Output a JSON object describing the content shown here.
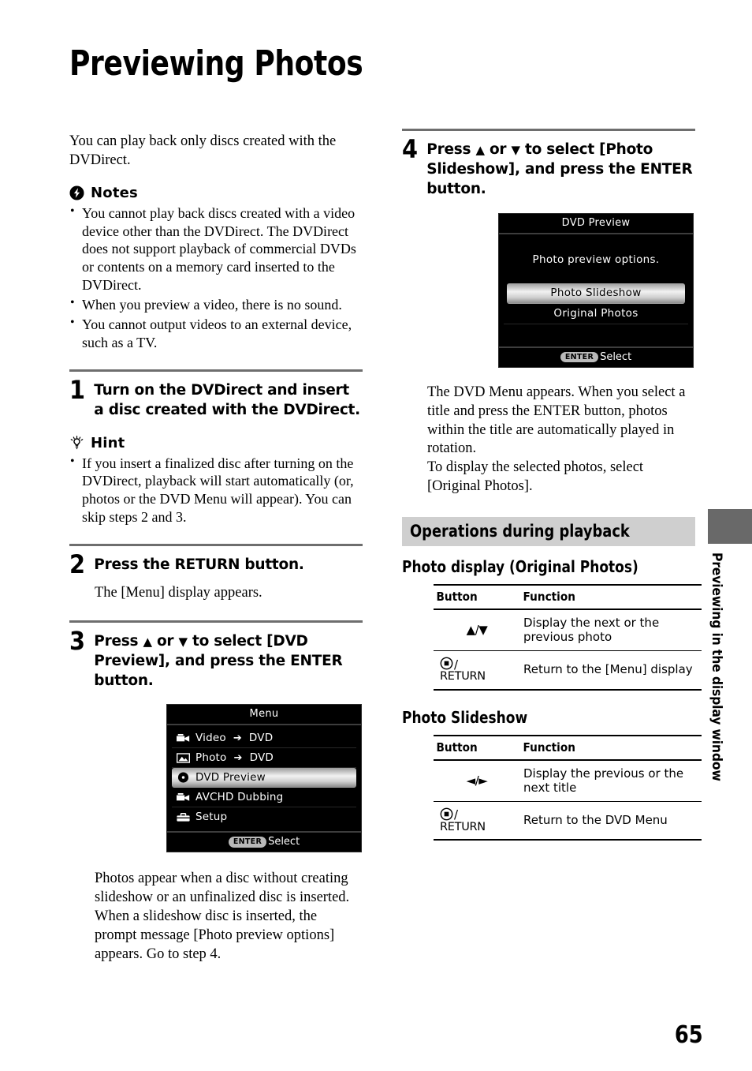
{
  "page": {
    "title": "Previewing Photos",
    "number": "65",
    "side_tab": "Previewing in the display window"
  },
  "left_column": {
    "intro": "You can play back only discs created with the DVDirect.",
    "notes": {
      "icon": "notes-exclamation-icon",
      "heading": "Notes",
      "items": [
        "You cannot play back discs created with a video device other than the DVDirect. The DVDirect does not support playback of commercial DVDs or contents on a memory card inserted to the DVDirect.",
        "When you preview a video, there is no sound.",
        "You cannot output videos to an external device, such as a TV."
      ]
    },
    "step1": {
      "number": "1",
      "text": "Turn on the DVDirect and insert a disc created with the DVDirect."
    },
    "hint": {
      "icon": "lightbulb-icon",
      "heading": "Hint",
      "items": [
        "If you insert a finalized disc after turning on the DVDirect, playback will start automatically (or, photos or the DVD Menu will appear). You can skip steps 2 and 3."
      ]
    },
    "step2": {
      "number": "2",
      "text": "Press the RETURN button.",
      "result": "The [Menu] display appears."
    },
    "step3": {
      "number": "3",
      "text_a": "Press ",
      "arrow_up": "♦",
      "text_b": " or ",
      "arrow_down": "♦",
      "text_c": " to select [DVD Preview], and press the ENTER button."
    },
    "menu_screen": {
      "title": "Menu",
      "rows": [
        {
          "icon": "video-camera-icon",
          "label": "Video",
          "arrow": "➔",
          "target": "DVD",
          "selected": false
        },
        {
          "icon": "photo-icon",
          "label": "Photo",
          "arrow": "➔",
          "target": "DVD",
          "selected": false
        },
        {
          "icon": "disc-icon",
          "label": "DVD  Preview",
          "arrow": "",
          "target": "",
          "selected": true
        },
        {
          "icon": "video-camera-icon",
          "label": "AVCHD  Dubbing",
          "arrow": "",
          "target": "",
          "selected": false
        },
        {
          "icon": "toolbox-icon",
          "label": "Setup",
          "arrow": "",
          "target": "",
          "selected": false
        }
      ],
      "footer_badge": "ENTER",
      "footer_label": "Select"
    },
    "closing": "Photos appear when a disc without creating slideshow or an unfinalized disc is inserted. When a slideshow disc is inserted, the prompt message [Photo preview options] appears. Go to step 4."
  },
  "right_column": {
    "step4": {
      "number": "4",
      "text_a": "Press ",
      "arrow_up": "♦",
      "text_b": " or ",
      "arrow_down": "♦",
      "text_c": " to select [Photo Slideshow], and press the ENTER button."
    },
    "preview_screen": {
      "title": "DVD Preview",
      "message": "Photo  preview  options.",
      "options": [
        {
          "label": "Photo  Slideshow",
          "selected": true
        },
        {
          "label": "Original  Photos",
          "selected": false
        }
      ],
      "footer_badge": "ENTER",
      "footer_label": "Select"
    },
    "after_step4": "The DVD Menu appears. When you select a title and press the ENTER button, photos within the title are automatically played in rotation.\nTo display the selected photos, select [Original Photos].",
    "section_heading": "Operations during playback",
    "subsection_1": "Photo display (Original Photos)",
    "table_1": {
      "headers": [
        "Button",
        "Function"
      ],
      "rows": [
        {
          "button_type": "updown-arrows",
          "button_label": "♦/♦",
          "function": "Display the next or the previous photo"
        },
        {
          "button_type": "return-icon",
          "button_label": "/",
          "button_word": "RETURN",
          "function": "Return to the [Menu] display"
        }
      ]
    },
    "subsection_2": "Photo Slideshow",
    "table_2": {
      "headers": [
        "Button",
        "Function"
      ],
      "rows": [
        {
          "button_type": "leftright-arrows",
          "button_label": "♦/♦",
          "function": "Display the previous or the next title"
        },
        {
          "button_type": "return-icon",
          "button_label": "/",
          "button_word": "RETURN",
          "function": "Return to the DVD Menu"
        }
      ]
    }
  },
  "colors": {
    "rule": "#6e6e6e",
    "band": "#cfcfcf",
    "side_tab_block": "#696969",
    "screen_bg": "#000000"
  }
}
